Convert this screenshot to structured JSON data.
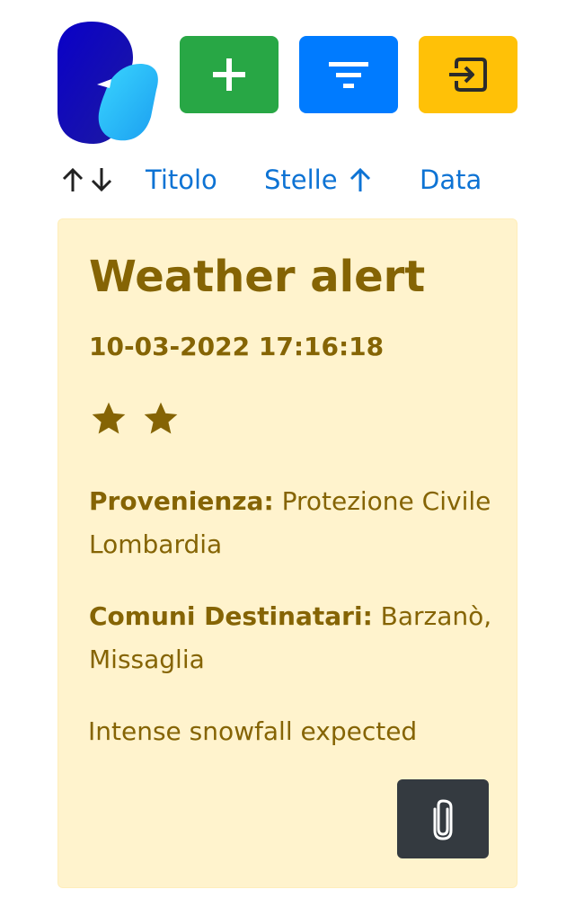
{
  "colors": {
    "add_button": "#28a745",
    "filter_button": "#007bff",
    "exit_button": "#ffc107",
    "link": "#0d73d4",
    "card_background": "#fff3cd",
    "card_text": "#856404",
    "attach_button": "#343a40",
    "logo_dark": "#0a00c8",
    "logo_light": "#2ec7f7"
  },
  "toolbar": {
    "add_icon": "plus-icon",
    "filter_icon": "filter-icon",
    "exit_icon": "sign-in-icon"
  },
  "sort": {
    "up_arrow": "↑",
    "down_arrow": "↓",
    "links": {
      "titolo": "Titolo",
      "stelle": "Stelle",
      "data": "Data"
    },
    "active_indicator": "↑"
  },
  "alert": {
    "title": "Weather alert",
    "datetime": "10-03-2022 17:16:18",
    "stars": 2,
    "provenienza_label": "Provenienza:",
    "provenienza_value": "Protezione Civile Lombardia",
    "comuni_label": "Comuni Destinatari:",
    "comuni_value": "Barzanò, Missaglia",
    "description": "Intense snowfall expected",
    "attach_icon": "paperclip-icon"
  }
}
